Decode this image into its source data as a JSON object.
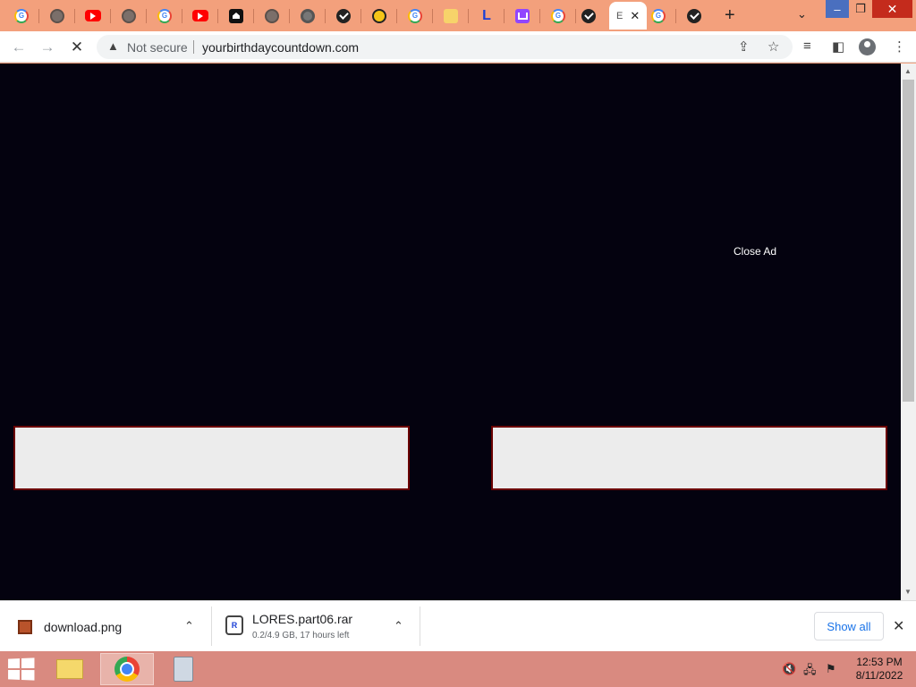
{
  "browser": {
    "tabs": [
      {
        "icon": "google-icon"
      },
      {
        "icon": "globe-icon"
      },
      {
        "icon": "youtube-icon"
      },
      {
        "icon": "globe-icon"
      },
      {
        "icon": "google-icon"
      },
      {
        "icon": "youtube-icon"
      },
      {
        "icon": "home-icon"
      },
      {
        "icon": "globe-icon"
      },
      {
        "icon": "chrome-icon"
      },
      {
        "icon": "shield-icon"
      },
      {
        "icon": "yellow-circle-icon"
      },
      {
        "icon": "google-icon"
      },
      {
        "icon": "mail-icon"
      },
      {
        "icon": "l-logo-icon"
      },
      {
        "icon": "twitch-icon"
      },
      {
        "icon": "google-icon"
      },
      {
        "icon": "shield-icon"
      }
    ],
    "active_tab": {
      "label": "E",
      "close": "✕"
    },
    "after_tabs": [
      {
        "icon": "google-icon"
      },
      {
        "icon": "shield-icon"
      }
    ],
    "new_tab_glyph": "+",
    "tab_search_glyph": "⌄",
    "window": {
      "minimize": "–",
      "maximize": "❐",
      "close": "✕"
    }
  },
  "toolbar": {
    "back": "←",
    "forward": "→",
    "reload": "✕",
    "security_icon": "▲",
    "security_label": "Not secure",
    "url": "yourbirthdaycountdown.com",
    "share_glyph": "⇪",
    "bookmark_glyph": "☆",
    "media_glyph": "≡",
    "sidepanel_glyph": "◧",
    "menu_glyph": "⋮"
  },
  "page": {
    "close_ad_label": "Close Ad",
    "background": "#04020f"
  },
  "downloads": {
    "items": [
      {
        "name": "download.png",
        "status": ""
      },
      {
        "name": "LORES.part06.rar",
        "status": "0.2/4.9 GB, 17 hours left"
      }
    ],
    "caret": "⌃",
    "show_all": "Show all",
    "close": "✕"
  },
  "taskbar": {
    "time": "12:53 PM",
    "date": "8/11/2022",
    "tray": {
      "volume": "🔇",
      "network": "🖧",
      "flag": "⚑"
    }
  }
}
